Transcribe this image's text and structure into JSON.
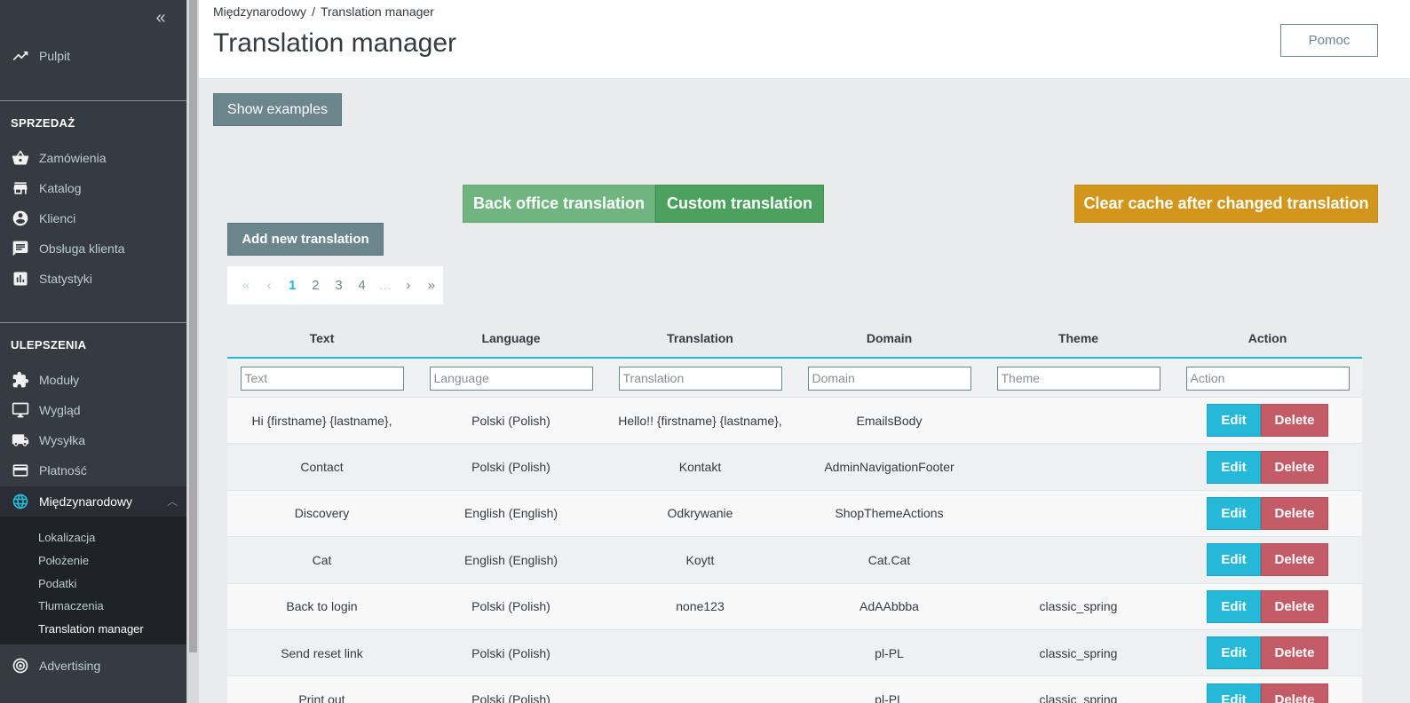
{
  "sidebar": {
    "collapse_icon": "double-chevron-left-icon",
    "dashboard": {
      "label": "Pulpit",
      "icon": "trending-up-icon"
    },
    "sales_section": "SPRZEDAŻ",
    "sales_items": [
      {
        "label": "Zamówienia",
        "icon": "basket-icon"
      },
      {
        "label": "Katalog",
        "icon": "store-icon"
      },
      {
        "label": "Klienci",
        "icon": "account-circle-icon"
      },
      {
        "label": "Obsługa klienta",
        "icon": "chat-icon"
      },
      {
        "label": "Statystyki",
        "icon": "bar-chart-icon"
      }
    ],
    "improve_section": "ULEPSZENIA",
    "improve_items": [
      {
        "label": "Moduły",
        "icon": "puzzle-icon"
      },
      {
        "label": "Wygląd",
        "icon": "desktop-icon"
      },
      {
        "label": "Wysyłka",
        "icon": "truck-icon"
      },
      {
        "label": "Płatność",
        "icon": "credit-card-icon"
      },
      {
        "label": "Międzynarodowy",
        "icon": "globe-icon"
      }
    ],
    "international_submenu": [
      "Lokalizacja",
      "Położenie",
      "Podatki",
      "Tłumaczenia",
      "Translation manager"
    ],
    "advertising": {
      "label": "Advertising",
      "icon": "radar-icon"
    }
  },
  "header": {
    "breadcrumb_parent": "Międzynarodowy",
    "breadcrumb_sep": "/",
    "breadcrumb_current": "Translation manager",
    "title": "Translation manager",
    "help_label": "Pomoc"
  },
  "toolbar": {
    "show_examples": "Show examples",
    "back_office_translation": "Back office translation",
    "custom_translation": "Custom translation",
    "clear_cache": "Clear cache after changed translation",
    "add_new_translation": "Add new translation"
  },
  "pagination": {
    "first": "«",
    "prev": "‹",
    "pages": [
      "1",
      "2",
      "3",
      "4"
    ],
    "current": "1",
    "ellipsis": "…",
    "next": "›",
    "last": "»"
  },
  "table": {
    "columns": [
      "Text",
      "Language",
      "Translation",
      "Domain",
      "Theme",
      "Action"
    ],
    "filter_placeholders": [
      "Text",
      "Language",
      "Translation",
      "Domain",
      "Theme",
      "Action"
    ],
    "edit_label": "Edit",
    "delete_label": "Delete",
    "rows": [
      {
        "text": "Hi {firstname} {lastname},",
        "language": "Polski (Polish)",
        "translation": "Hello!! {firstname} {lastname},",
        "domain": "EmailsBody",
        "theme": ""
      },
      {
        "text": "Contact",
        "language": "Polski (Polish)",
        "translation": "Kontakt",
        "domain": "AdminNavigationFooter",
        "theme": ""
      },
      {
        "text": "Discovery",
        "language": "English (English)",
        "translation": "Odkrywanie",
        "domain": "ShopThemeActions",
        "theme": ""
      },
      {
        "text": "Cat",
        "language": "English (English)",
        "translation": "Koytt",
        "domain": "Cat.Cat",
        "theme": ""
      },
      {
        "text": "Back to login",
        "language": "Polski (Polish)",
        "translation": "none123",
        "domain": "AdAAbbba",
        "theme": "classic_spring"
      },
      {
        "text": "Send reset link",
        "language": "Polski (Polish)",
        "translation": "",
        "domain": "pl-PL",
        "theme": "classic_spring"
      },
      {
        "text": "Print out",
        "language": "Polski (Polish)",
        "translation": "",
        "domain": "pl-PL",
        "theme": "classic_spring"
      }
    ]
  },
  "colors": {
    "sidebar_bg": "#363a41",
    "accent": "#25b9d7",
    "edit": "#25b9d7",
    "delete": "#c45c68",
    "warning": "#d3961c",
    "success": "#4da15e",
    "secondary": "#6c868e"
  }
}
